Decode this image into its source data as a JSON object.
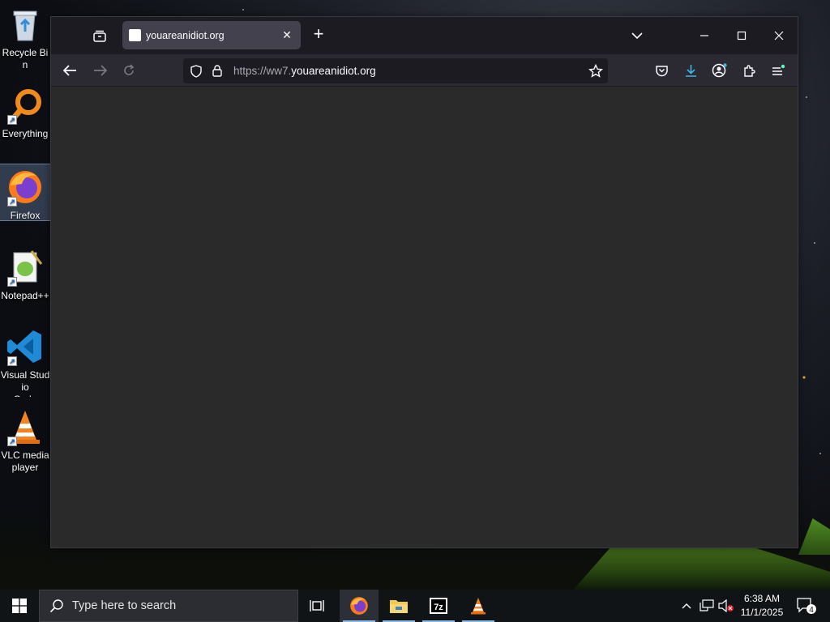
{
  "desktop": {
    "icons": [
      {
        "label": "Recycle Bin"
      },
      {
        "label": "Everything"
      },
      {
        "label": "Firefox"
      },
      {
        "label": "Notepad++"
      },
      {
        "label": "Visual Studio\nCode"
      },
      {
        "label": "VLC media\nplayer"
      }
    ]
  },
  "browser": {
    "tab": {
      "title": "youareanidiot.org"
    },
    "url": {
      "prefix": "https://ww7.",
      "domain": "youareanidiot.org"
    },
    "content_color": "#2b2a2a"
  },
  "taskbar": {
    "search_placeholder": "Type here to search",
    "clock_time": "6:38 AM",
    "clock_date": "11/1/2025",
    "notification_count": "4"
  }
}
